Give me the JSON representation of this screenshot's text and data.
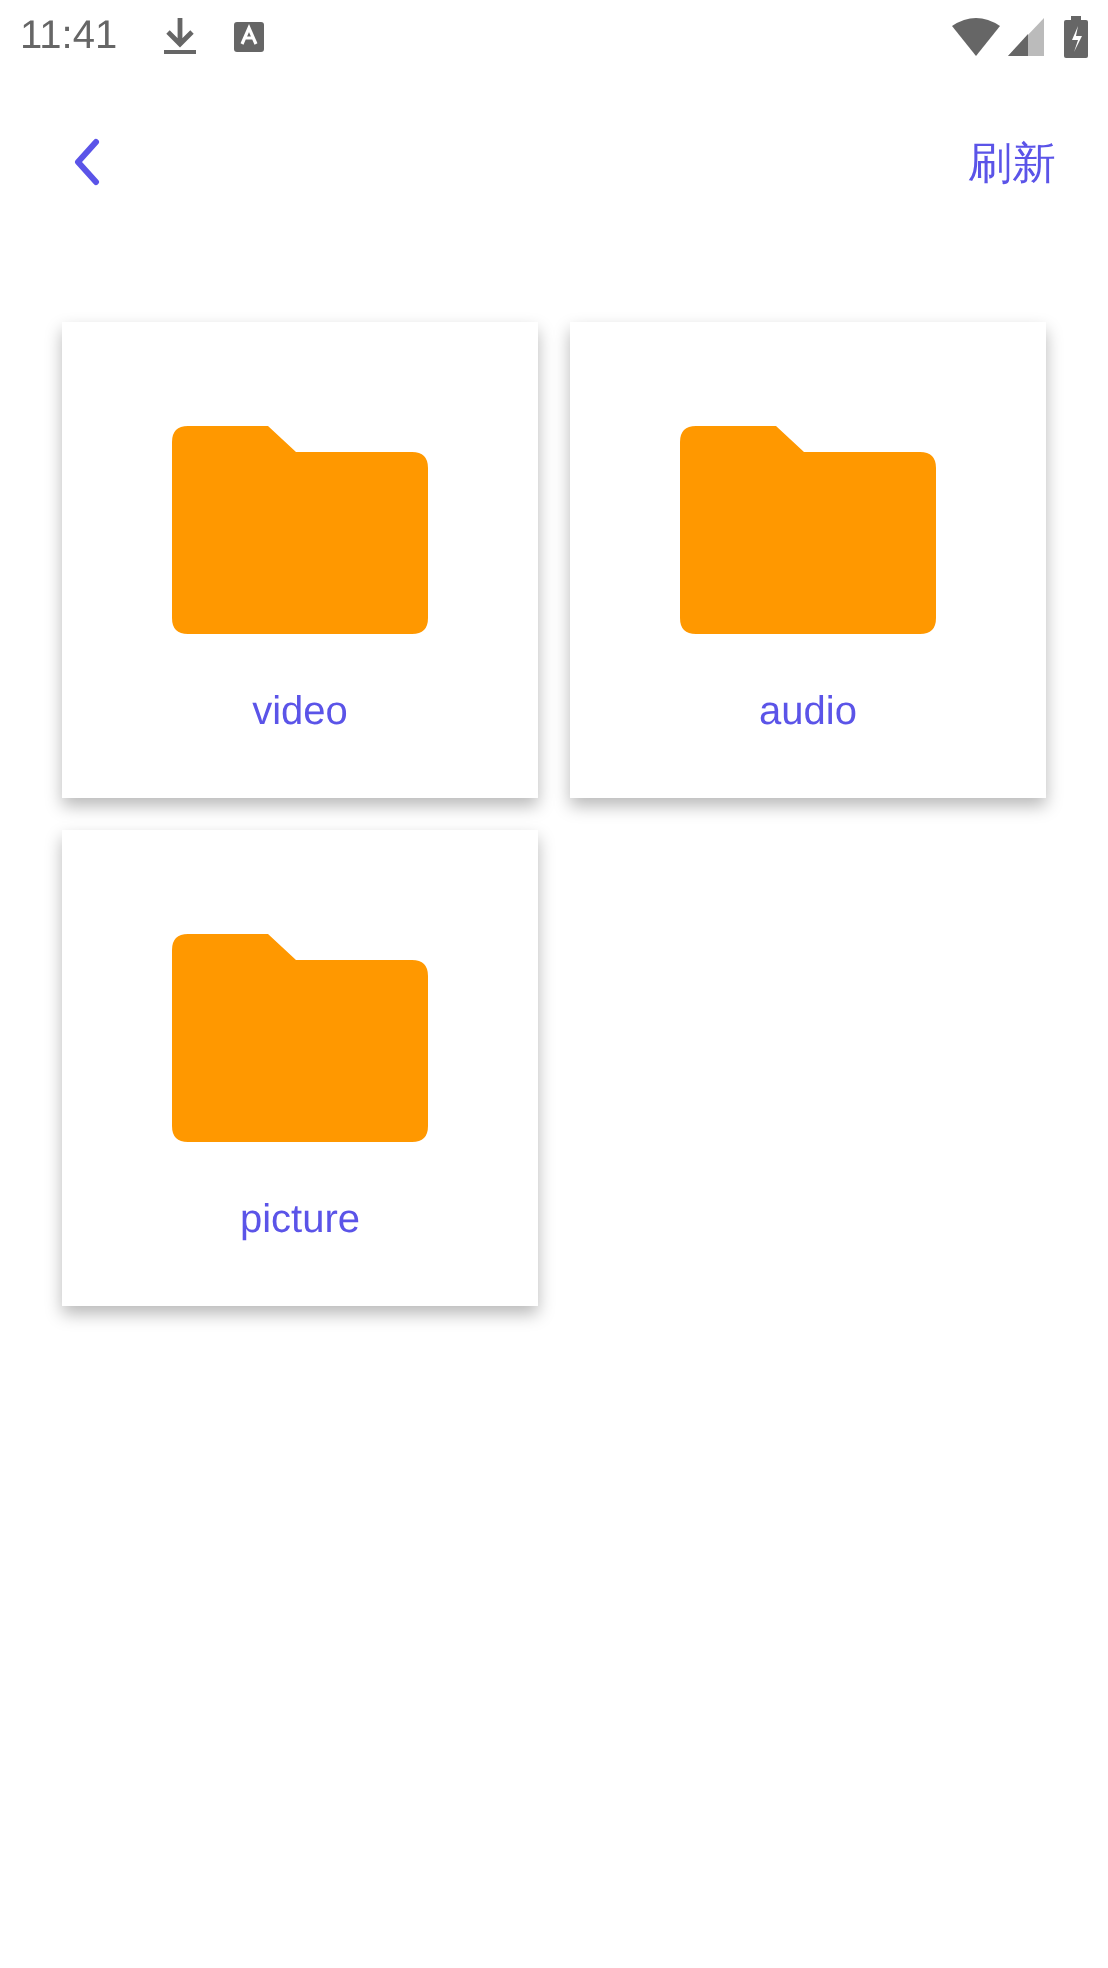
{
  "status_bar": {
    "time": "11:41"
  },
  "app_bar": {
    "action": "刷新"
  },
  "folders": [
    {
      "name": "video"
    },
    {
      "name": "audio"
    },
    {
      "name": "picture"
    }
  ]
}
